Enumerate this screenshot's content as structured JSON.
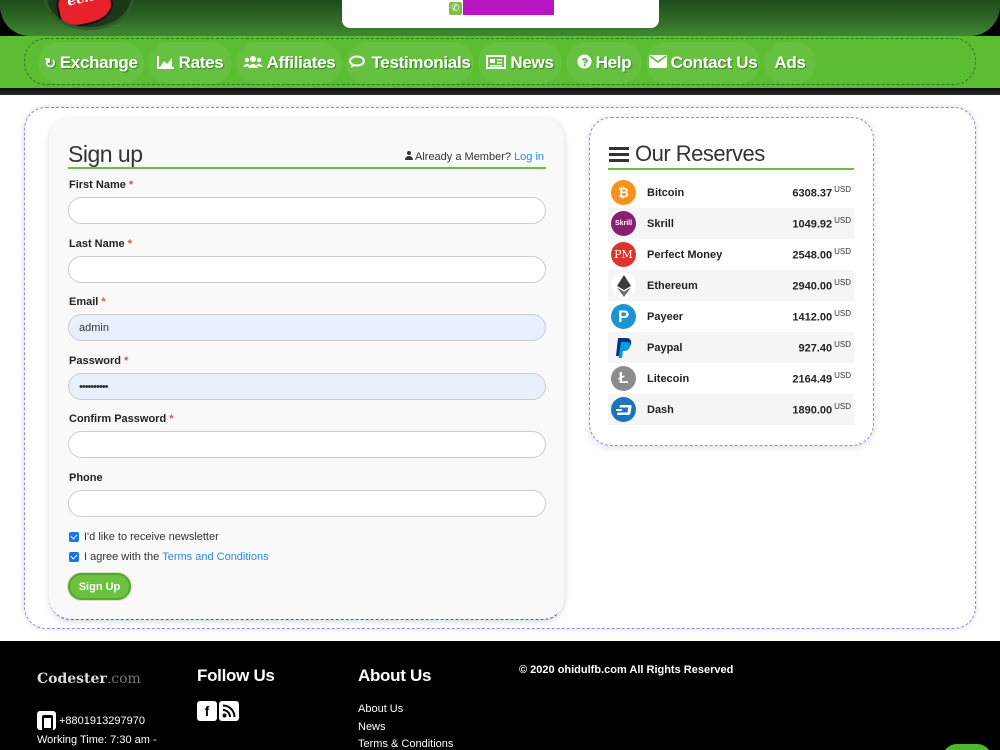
{
  "header": {
    "logo_text": "ech"
  },
  "nav": {
    "items": [
      {
        "label": "Exchange",
        "icon": "refresh-icon"
      },
      {
        "label": "Rates",
        "icon": "area-chart-icon"
      },
      {
        "label": "Affiliates",
        "icon": "users-icon"
      },
      {
        "label": "Testimonials",
        "icon": "comments-icon"
      },
      {
        "label": "News",
        "icon": "newspaper-icon"
      },
      {
        "label": "Help",
        "icon": "question-circle-icon"
      },
      {
        "label": "Contact Us",
        "icon": "envelope-icon"
      },
      {
        "label": "Ads",
        "icon": ""
      }
    ]
  },
  "signup": {
    "title": "Sign up",
    "member_prompt": "Already a Member?",
    "login_label": "Log in",
    "fields": {
      "first_name": {
        "label": "First Name",
        "value": ""
      },
      "last_name": {
        "label": "Last Name",
        "value": ""
      },
      "email": {
        "label": "Email",
        "value": "admin"
      },
      "password": {
        "label": "Password",
        "value": "••••••••••"
      },
      "confirm_password": {
        "label": "Confirm Password",
        "value": ""
      },
      "phone": {
        "label": "Phone",
        "value": ""
      }
    },
    "required_mark": "*",
    "newsletter_label": "I'd like to receive newsletter",
    "agree_label": "I agree with the",
    "terms_label": "Terms and Conditions",
    "submit_label": "Sign Up"
  },
  "reserves": {
    "title": "Our Reserves",
    "currency": "USD",
    "items": [
      {
        "name": "Bitcoin",
        "amount": "6308.37",
        "icon": "bitcoin-icon",
        "color": "#f7931a",
        "glyph": "₿"
      },
      {
        "name": "Skrill",
        "amount": "1049.92",
        "icon": "skrill-icon",
        "color": "#8a1e6f",
        "glyph": "Skrill"
      },
      {
        "name": "Perfect Money",
        "amount": "2548.00",
        "icon": "perfect-money-icon",
        "color": "#e0312b",
        "glyph": "PM"
      },
      {
        "name": "Ethereum",
        "amount": "2940.00",
        "icon": "ethereum-icon",
        "color": "#ffffff",
        "glyph": "◆"
      },
      {
        "name": "Payeer",
        "amount": "1412.00",
        "icon": "payeer-icon",
        "color": "#1d93d2",
        "glyph": "P"
      },
      {
        "name": "Paypal",
        "amount": "927.40",
        "icon": "paypal-icon",
        "color": "#ffffff",
        "glyph": "P"
      },
      {
        "name": "Litecoin",
        "amount": "2164.49",
        "icon": "litecoin-icon",
        "color": "#8c8c8c",
        "glyph": "Ł"
      },
      {
        "name": "Dash",
        "amount": "1890.00",
        "icon": "dash-icon",
        "color": "#1c75bc",
        "glyph": "D"
      }
    ]
  },
  "footer": {
    "brand_main": "Codester",
    "brand_suffix": ".com",
    "follow_heading": "Follow Us",
    "about_heading": "About Us",
    "about_links": [
      "About Us",
      "News",
      "Terms & Conditions"
    ],
    "copyright": "© 2020 ohidulfb.com All Rights Reserved",
    "phone": "+8801913297970",
    "hours": "Working Time: 7:30 am -"
  },
  "colors": {
    "nav_green": "#5bbd32",
    "accent_green": "#6cc13f",
    "link_blue": "#2a8ae0"
  }
}
